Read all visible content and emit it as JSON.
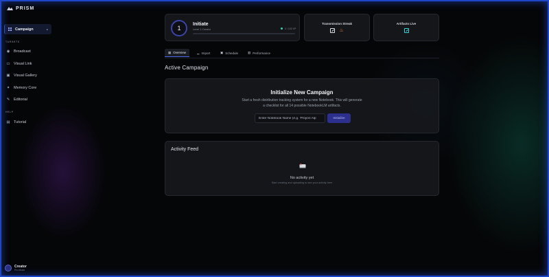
{
  "brand": {
    "name": "PRISM"
  },
  "sidebar": {
    "campaign_label": "Campaign",
    "section_tools": "TARGETS",
    "items": [
      {
        "label": "Broadcast",
        "icon": "broadcast-icon"
      },
      {
        "label": "Visual Link",
        "icon": "link-icon"
      },
      {
        "label": "Visual Gallery",
        "icon": "gallery-icon"
      },
      {
        "label": "Memory Core",
        "icon": "memory-icon"
      },
      {
        "label": "Editorial",
        "icon": "edit-icon"
      }
    ],
    "section_help": "HELP",
    "help_items": [
      {
        "label": "Tutorial",
        "icon": "book-icon"
      }
    ],
    "user": {
      "name": "Creator",
      "role": "Pro Mode"
    }
  },
  "level_card": {
    "level": "1",
    "title": "Initiate",
    "subtitle": "Level 1 Creator",
    "xp_text": "0 / 100 XP",
    "progress": 0.0
  },
  "streak_card": {
    "title": "Transmission Streak"
  },
  "artifacts_card": {
    "title": "Artifacts Live"
  },
  "tabs": [
    {
      "label": "Overview",
      "active": true
    },
    {
      "label": "Import",
      "active": false
    },
    {
      "label": "Schedule",
      "active": false
    },
    {
      "label": "Performance",
      "active": false
    }
  ],
  "main": {
    "heading": "Active Campaign",
    "new_campaign": {
      "title": "Initialize New Campaign",
      "description": "Start a fresh distribution tracking system for a new Notebook. This will generate a checklist for all 14 possible NotebookLM artifacts.",
      "input_placeholder": "Enter Notebook Name (e.g. 'Project Alp",
      "button_label": "Initialize"
    },
    "activity": {
      "title": "Activity Feed",
      "empty_title": "No activity yet",
      "empty_subtitle": "Start creating and uploading to see your activity here"
    }
  },
  "colors": {
    "accent": "#4b6cf0",
    "button": "#2c2f8c",
    "teal": "#37d6dc",
    "flame": "#ff8a2a",
    "frame": "#1e46c8"
  }
}
